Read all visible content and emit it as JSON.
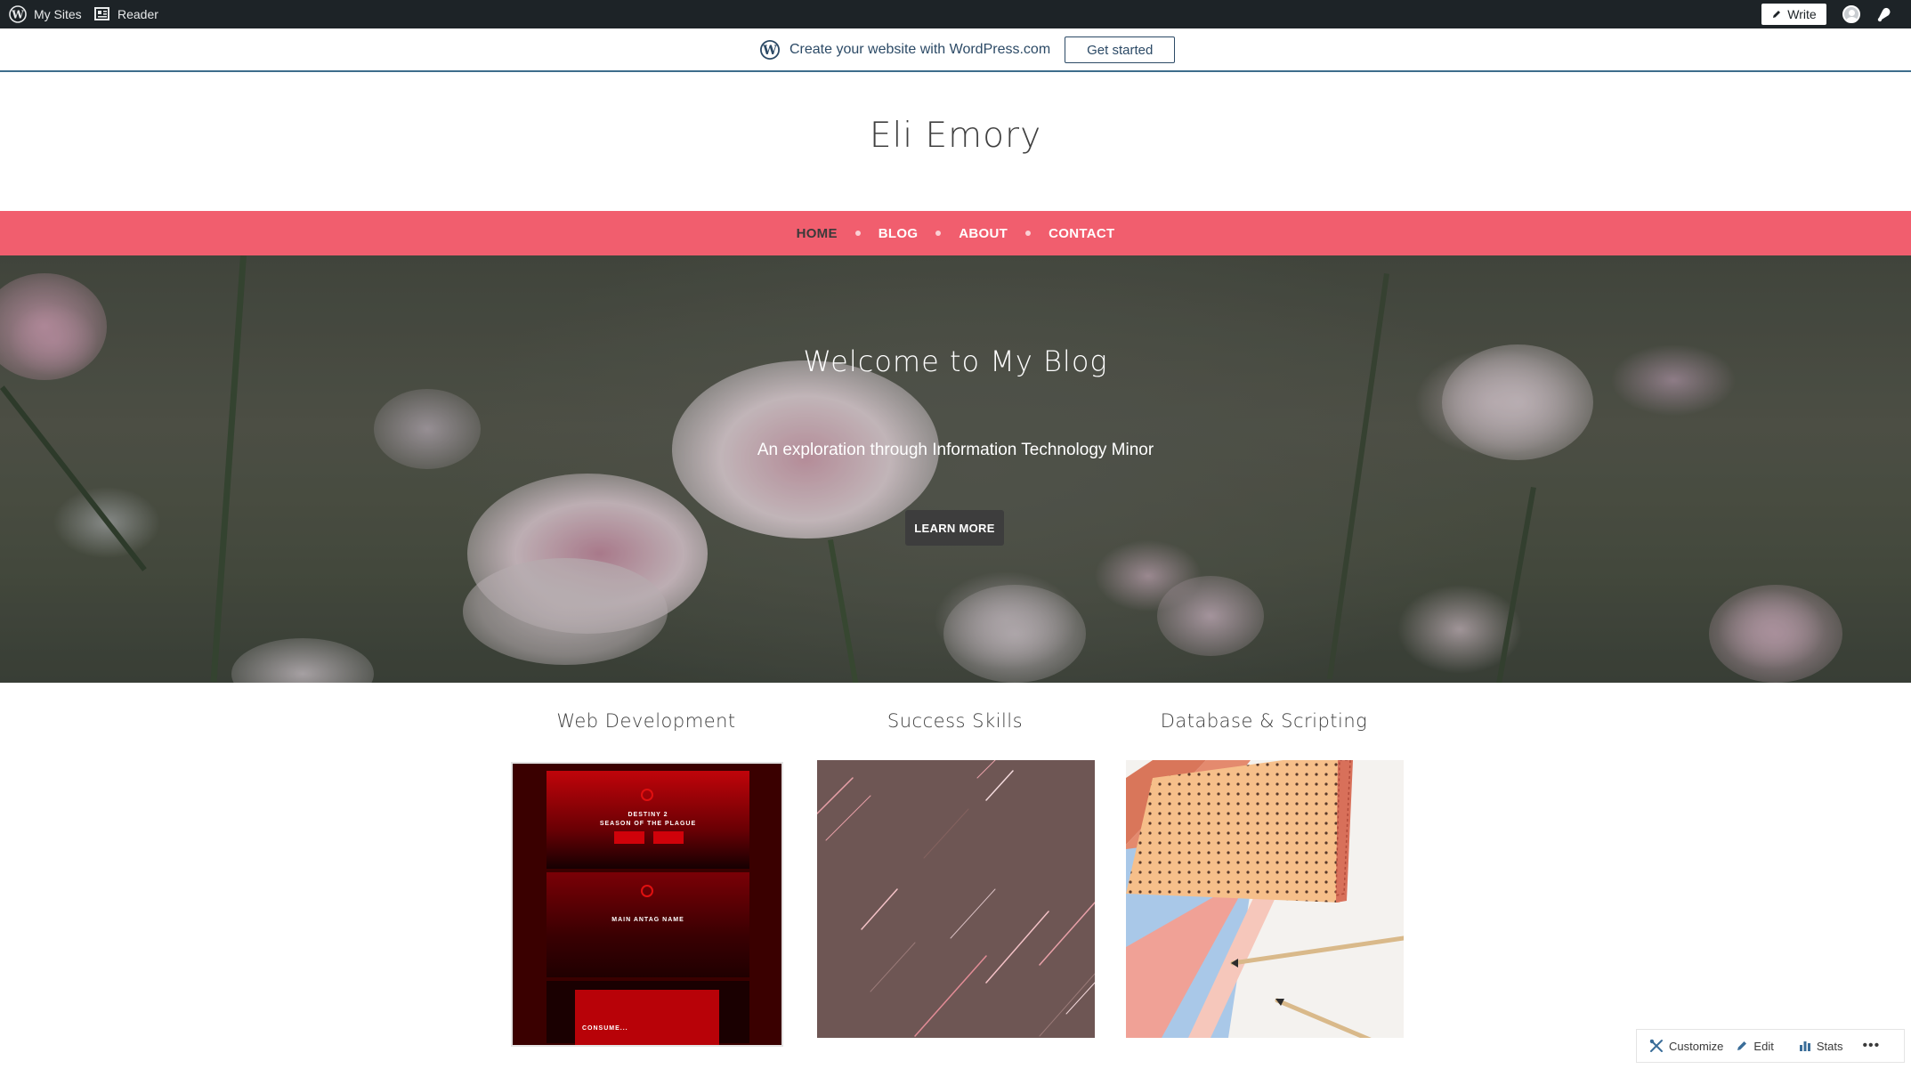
{
  "adminbar": {
    "my_sites": "My Sites",
    "reader": "Reader",
    "write": "Write"
  },
  "banner": {
    "text": "Create your website with WordPress.com",
    "button": "Get started"
  },
  "site": {
    "title": "Eli Emory"
  },
  "nav": {
    "items": [
      {
        "label": "HOME"
      },
      {
        "label": "BLOG"
      },
      {
        "label": "ABOUT"
      },
      {
        "label": "CONTACT"
      }
    ],
    "active": "HOME"
  },
  "hero": {
    "title": "Welcome to My Blog",
    "subtitle": "An exploration through Information Technology Minor",
    "button": "LEARN MORE"
  },
  "features": [
    {
      "title": "Web Development"
    },
    {
      "title": "Success Skills"
    },
    {
      "title": "Database & Scripting"
    }
  ],
  "destiny_thumb": {
    "line1": "DESTINY 2",
    "line2": "SEASON OF THE PLAGUE",
    "line3": "MAIN ANTAG NAME",
    "line4": "CONSUME..."
  },
  "actions": {
    "customize": "Customize",
    "edit": "Edit",
    "stats": "Stats"
  },
  "colors": {
    "nav_bg": "#f15e6e",
    "adminbar_bg": "#1d2327",
    "banner_accent": "#2c4a66"
  }
}
